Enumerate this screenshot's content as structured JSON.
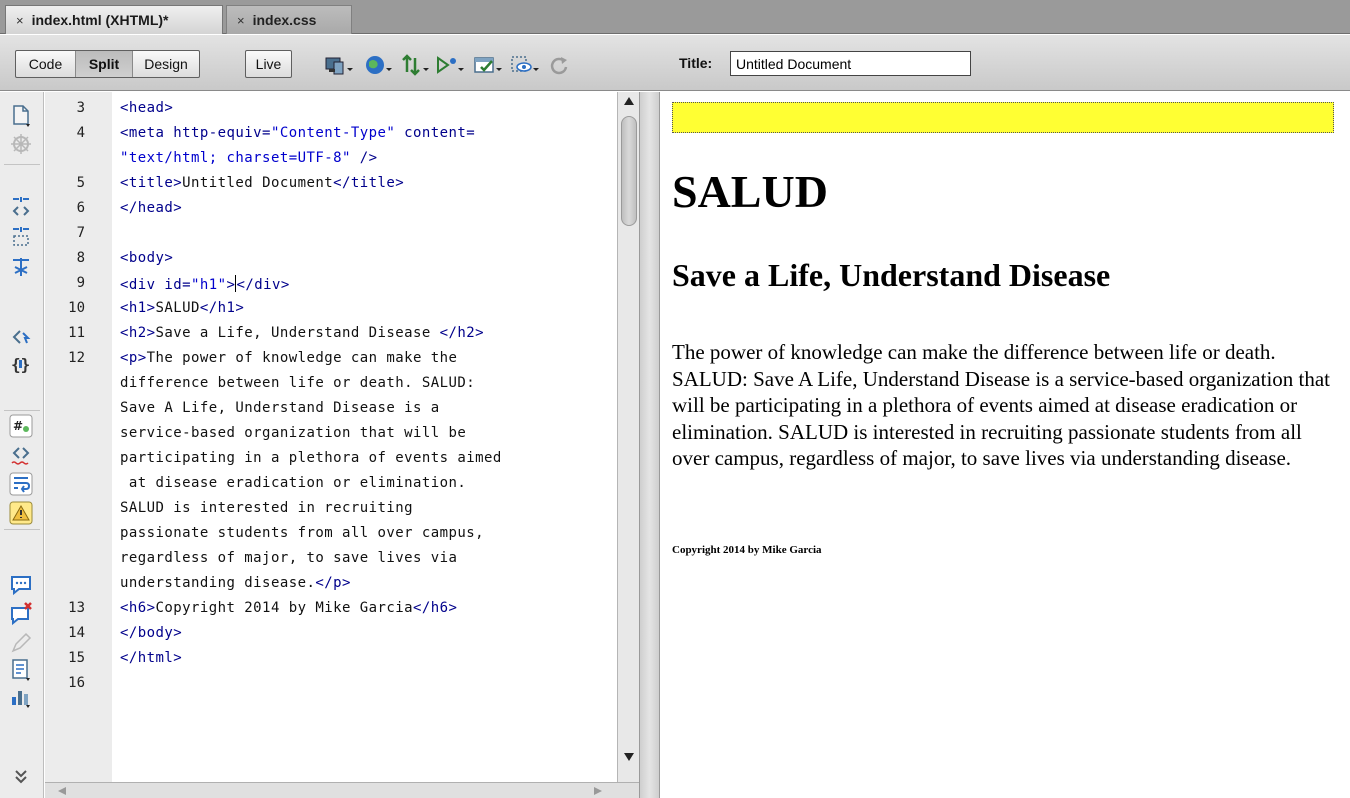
{
  "tabs": [
    {
      "close": "×",
      "label": "index.html (XHTML)*"
    },
    {
      "close": "×",
      "label": "index.css"
    }
  ],
  "toolbar": {
    "view_buttons": [
      "Code",
      "Split",
      "Design"
    ],
    "active_view": "Split",
    "live_label": "Live",
    "icons": [
      "multiscreen-icon",
      "preview-globe-icon",
      "file-management-icon",
      "debug-browser-icon",
      "validate-icon",
      "visual-aids-icon",
      "refresh-icon"
    ],
    "title_label": "Title:",
    "title_value": "Untitled Document"
  },
  "left_strip_icons": [
    "open-documents-icon",
    "show-code-navigator-icon",
    "collapse-full-tag-icon",
    "collapse-selection-icon",
    "expand-all-icon",
    "select-parent-tag-icon",
    "balance-braces-icon",
    "line-numbers-icon",
    "highlight-invalid-code-icon",
    "word-wrap-icon",
    "syntax-error-alerts-icon",
    "apply-comment-icon",
    "remove-comment-icon",
    "wrap-tag-icon",
    "recent-snippets-icon",
    "move-css-icon",
    "more-tools-icon"
  ],
  "code": {
    "lines": [
      {
        "num": "3",
        "text": "<head>"
      },
      {
        "num": "4",
        "text": "<meta http-equiv=\"Content-Type\" content="
      },
      {
        "num": "",
        "text": "\"text/html; charset=UTF-8\" />"
      },
      {
        "num": "5",
        "text": "<title>Untitled Document</title>"
      },
      {
        "num": "6",
        "text": "</head>"
      },
      {
        "num": "7",
        "text": ""
      },
      {
        "num": "8",
        "text": "<body>"
      },
      {
        "num": "9",
        "text": "<div id=\"h1\"></div>"
      },
      {
        "num": "10",
        "text": "<h1>SALUD</h1>"
      },
      {
        "num": "11",
        "text": "<h2>Save a Life, Understand Disease </h2>"
      },
      {
        "num": "12",
        "text": "<p>The power of knowledge can make the"
      },
      {
        "num": "",
        "text": "difference between life or death. SALUD:"
      },
      {
        "num": "",
        "text": "Save A Life, Understand Disease is a"
      },
      {
        "num": "",
        "text": "service-based organization that will be"
      },
      {
        "num": "",
        "text": "participating in a plethora of events aimed"
      },
      {
        "num": "",
        "text": " at disease eradication or elimination."
      },
      {
        "num": "",
        "text": "SALUD is interested in recruiting"
      },
      {
        "num": "",
        "text": "passionate students from all over campus,"
      },
      {
        "num": "",
        "text": "regardless of major, to save lives via"
      },
      {
        "num": "",
        "text": "understanding disease.</p>"
      },
      {
        "num": "13",
        "text": "<h6>Copyright 2014 by Mike Garcia</h6>"
      },
      {
        "num": "14",
        "text": "</body>"
      },
      {
        "num": "15",
        "text": "</html>"
      },
      {
        "num": "16",
        "text": ""
      }
    ]
  },
  "design": {
    "highlight_color": "#ffff33",
    "h1": "SALUD",
    "h2": "Save a Life, Understand Disease",
    "paragraph": "The power of knowledge can make the difference between life or death. SALUD: Save A Life, Understand Disease is a service-based organization that will be participating in a plethora of events aimed at disease eradication or elimination. SALUD is interested in recruiting passionate students from all over campus, regardless of major, to save lives via understanding disease.",
    "h6": "Copyright 2014 by Mike Garcia"
  },
  "colors": {
    "tag": "#00008b",
    "string": "#0000cd",
    "toolbar": "#d6d6d6"
  }
}
